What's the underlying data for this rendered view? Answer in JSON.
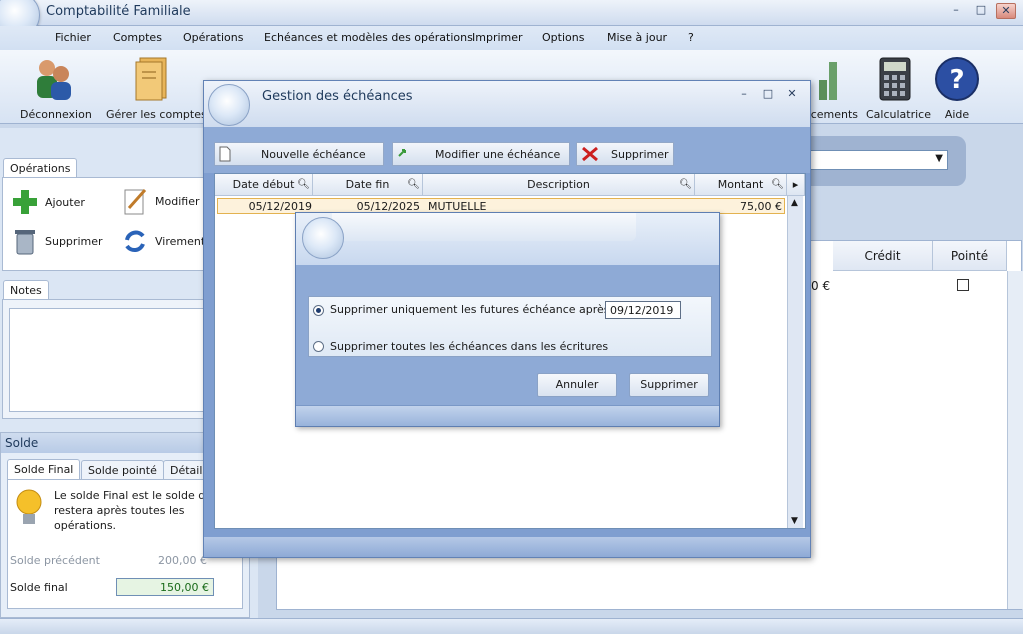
{
  "app": {
    "title": "Comptabilité Familiale"
  },
  "menu": [
    "Fichier",
    "Comptes",
    "Opérations",
    "Echéances et modèles des opérations",
    "Imprimer",
    "Options",
    "Mise à jour",
    "?"
  ],
  "ribbon": {
    "deconnexion": "Déconnexion",
    "gerer_comptes": "Gérer les comptes",
    "placements": "acements",
    "calculatrice": "Calculatrice",
    "aide": "Aide"
  },
  "left": {
    "operations_tab": "Opérations",
    "ajouter": "Ajouter",
    "modifier": "Modifier",
    "supprimer": "Supprimer",
    "virements": "Virements",
    "notes_tab": "Notes",
    "solde": {
      "title": "Solde",
      "tabs": [
        "Solde Final",
        "Solde pointé",
        "Détails"
      ],
      "info": "Le solde Final est le solde qui restera après toutes les opérations.",
      "prev_label": "Solde précédent",
      "prev_value": "200,00 €",
      "final_label": "Solde final",
      "final_value": "150,00 €"
    }
  },
  "right_grid": {
    "credit": "Crédit",
    "pointe": "Pointé",
    "partial_value": "0 €"
  },
  "dialog_echeances": {
    "title": "Gestion des échéances",
    "new_btn": "Nouvelle échéance",
    "edit_btn": "Modifier une échéance",
    "delete_btn": "Supprimer",
    "columns": [
      "Date début",
      "Date fin",
      "Description",
      "Montant"
    ],
    "rows": [
      {
        "date_debut": "05/12/2019",
        "date_fin": "05/12/2025",
        "description": "MUTUELLE",
        "montant": "75,00 €"
      }
    ]
  },
  "dialog_confirm": {
    "option1": "Supprimer uniquement les futures échéance après le :",
    "date": "09/12/2019",
    "option2": "Supprimer toutes les échéances dans les écritures",
    "cancel": "Annuler",
    "ok": "Supprimer"
  }
}
